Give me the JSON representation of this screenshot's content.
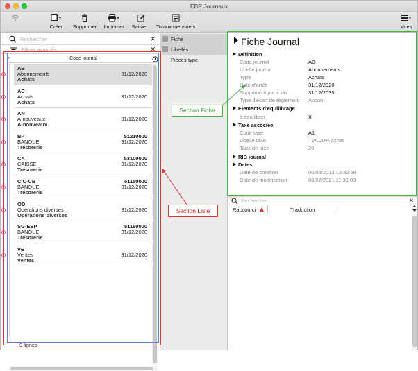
{
  "window": {
    "title": "EBP Journaux"
  },
  "toolbar": {
    "creer": "Créer",
    "supprimer": "Supprimer",
    "imprimer": "Imprimer",
    "saisie": "Saisie...",
    "totaux": "Totaux mensuels",
    "vues": "Vues"
  },
  "left": {
    "search_placeholder": "Rechercher",
    "filter_placeholder": "Filtres avancés",
    "column_header": "Code journal",
    "footer_count": "9 lignes",
    "records": [
      {
        "code": "AB",
        "libelle": "Abonnements",
        "type": "Achats",
        "compte": "",
        "date": "31/12/2020",
        "selected": true
      },
      {
        "code": "AC",
        "libelle": "Achats",
        "type": "Achats",
        "compte": "",
        "date": "31/12/2020"
      },
      {
        "code": "AN",
        "libelle": "A-nouveaux",
        "type": "A-nouveaux",
        "compte": "",
        "date": "31/12/2020"
      },
      {
        "code": "BP",
        "libelle": "BANQUE",
        "type": "Trésorerie",
        "compte": "51210000",
        "date": "31/12/2020"
      },
      {
        "code": "CA",
        "libelle": "CAISSE",
        "type": "Trésorerie",
        "compte": "53100000",
        "date": "31/12/2020"
      },
      {
        "code": "CIC-CB",
        "libelle": "BANQUE",
        "type": "Trésorerie",
        "compte": "51150000",
        "date": "31/12/2020"
      },
      {
        "code": "OD",
        "libelle": "Opérations diverses",
        "type": "Opérations diverses",
        "compte": "",
        "date": "31/12/2020"
      },
      {
        "code": "SG-ESP",
        "libelle": "BANQUE",
        "type": "Trésorerie",
        "compte": "51160000",
        "date": "31/12/2020"
      },
      {
        "code": "VE",
        "libelle": "Ventes",
        "type": "Ventes",
        "compte": "",
        "date": "31/12/2020"
      }
    ]
  },
  "middle": {
    "items": [
      {
        "label": "Fiche",
        "active": true
      },
      {
        "label": "Libellés",
        "active": true
      },
      {
        "label": "Pièces-type",
        "active": false
      }
    ]
  },
  "fiche": {
    "title": "Fiche Journal",
    "sections": {
      "definition": "Définition",
      "equilibrage": "Elements d'équilibrage",
      "taxe": "Taxe associée",
      "rib": "RIB journal",
      "dates": "Dates"
    },
    "fields": {
      "code_label": "Code journal",
      "code_value": "AB",
      "libelle_label": "Libellé journal",
      "libelle_value": "Abonnements",
      "type_label": "Type",
      "type_value": "Achats",
      "date_arret_label": "Date d'arrêt",
      "date_arret_value": "31/12/2020",
      "supprime_label": "Supprimé à partir du",
      "supprime_value": "31/12/2035",
      "ecart_label": "Type d'écart de règlement",
      "ecart_value": "Aucun",
      "equilibrer_label": "à équilibrer",
      "equilibrer_value": "X",
      "code_taxe_label": "Code taxe",
      "code_taxe_value": "A1",
      "libelle_taxe_label": "Libellé taxe",
      "libelle_taxe_value": "TVA 20% achat",
      "taux_label": "Taux de taxe",
      "taux_value": "20",
      "creation_label": "Date de création",
      "creation_value": "06/06/2013 13:32:58",
      "modification_label": "Date de modification",
      "modification_value": "06/07/2021 11:33:03"
    }
  },
  "lower_right": {
    "search_placeholder": "Rechercher",
    "col_raccourci": "Raccourci",
    "col_traduction": "Traduction"
  },
  "annotations": {
    "section_liste": "Section Liste",
    "section_fiche": "Section Fiche"
  },
  "colors": {
    "annotation_red": "#dd3333",
    "annotation_green": "#47b347",
    "annotation_blue": "#5b7fd4",
    "marker_pink": "#e0506e"
  }
}
